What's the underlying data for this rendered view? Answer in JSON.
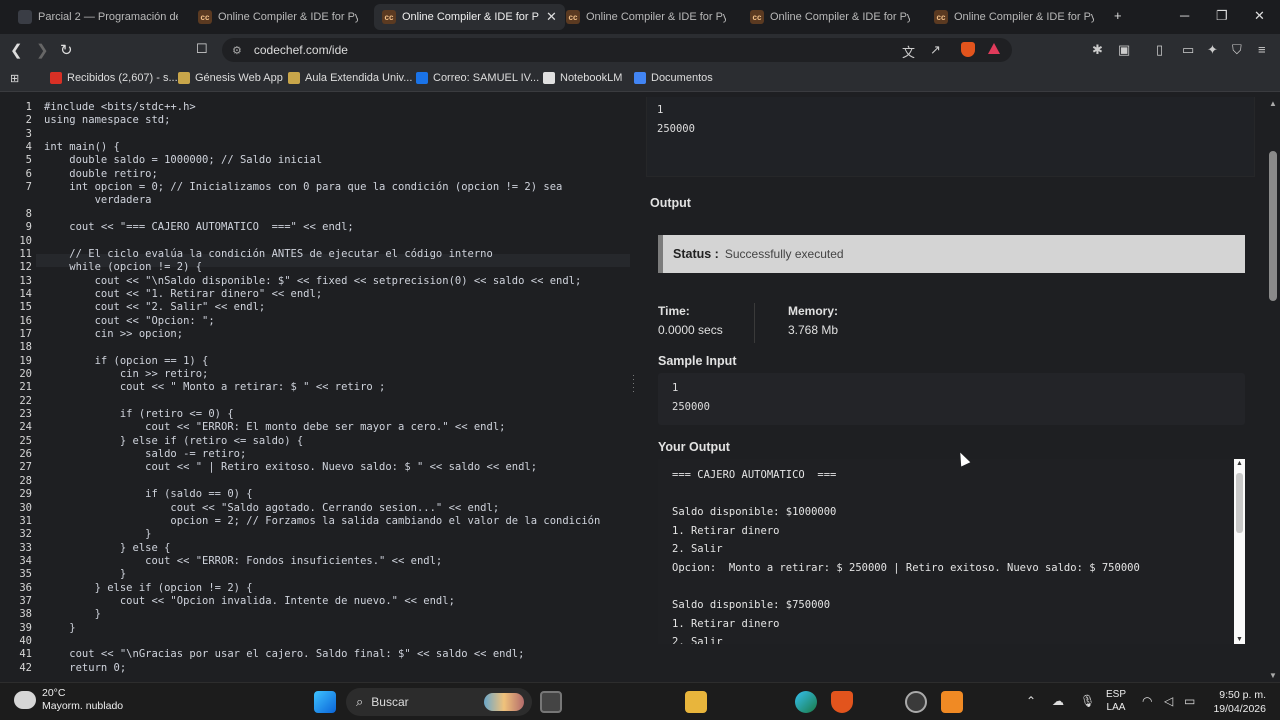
{
  "browser": {
    "tabs": [
      {
        "label": "Parcial 2 — Programación de Co",
        "favicon": "uni"
      },
      {
        "label": "Online Compiler & IDE for Pytho",
        "favicon": "cc"
      },
      {
        "label": "Online Compiler & IDE for P",
        "favicon": "cc",
        "active": true
      },
      {
        "label": "Online Compiler & IDE for Pytho",
        "favicon": "cc"
      },
      {
        "label": "Online Compiler & IDE for Pytho",
        "favicon": "cc"
      },
      {
        "label": "Online Compiler & IDE for Pytho",
        "favicon": "cc"
      }
    ],
    "url": "codechef.com/ide",
    "bookmarks": [
      {
        "label": "Recibidos (2,607) - s...",
        "color": "#d93025"
      },
      {
        "label": "Génesis Web App",
        "color": "#c9a64a"
      },
      {
        "label": "Aula Extendida Univ...",
        "color": "#c9a64a"
      },
      {
        "label": "Correo: SAMUEL IV...",
        "color": "#1a73e8"
      },
      {
        "label": "NotebookLM",
        "color": "#e0e0e0"
      },
      {
        "label": "Documentos",
        "color": "#4285f4"
      }
    ]
  },
  "editor": {
    "lines": [
      {
        "n": "1",
        "code": "#include <bits/stdc++.h>"
      },
      {
        "n": "2",
        "code": "using namespace std;"
      },
      {
        "n": "3",
        "code": ""
      },
      {
        "n": "4",
        "code": "int main() {"
      },
      {
        "n": "5",
        "code": "    double saldo = 1000000; // Saldo inicial"
      },
      {
        "n": "6",
        "code": "    double retiro;"
      },
      {
        "n": "7",
        "code": "    int opcion = 0; // Inicializamos con 0 para que la condición (opcion != 2) sea"
      },
      {
        "n": "",
        "code": "        verdadera"
      },
      {
        "n": "8",
        "code": ""
      },
      {
        "n": "9",
        "code": "    cout << \"=== CAJERO AUTOMATICO  ===\" << endl;"
      },
      {
        "n": "10",
        "code": ""
      },
      {
        "n": "11",
        "code": "    // El ciclo evalúa la condición ANTES de ejecutar el código interno"
      },
      {
        "n": "12",
        "code": "    while (opcion != 2) {"
      },
      {
        "n": "13",
        "code": "        cout << \"\\nSaldo disponible: $\" << fixed << setprecision(0) << saldo << endl;"
      },
      {
        "n": "14",
        "code": "        cout << \"1. Retirar dinero\" << endl;"
      },
      {
        "n": "15",
        "code": "        cout << \"2. Salir\" << endl;"
      },
      {
        "n": "16",
        "code": "        cout << \"Opcion: \";"
      },
      {
        "n": "17",
        "code": "        cin >> opcion;"
      },
      {
        "n": "18",
        "code": ""
      },
      {
        "n": "19",
        "code": "        if (opcion == 1) {"
      },
      {
        "n": "20",
        "code": "            cin >> retiro;"
      },
      {
        "n": "21",
        "code": "            cout << \" Monto a retirar: $ \" << retiro ;"
      },
      {
        "n": "22",
        "code": ""
      },
      {
        "n": "23",
        "code": "            if (retiro <= 0) {"
      },
      {
        "n": "24",
        "code": "                cout << \"ERROR: El monto debe ser mayor a cero.\" << endl;"
      },
      {
        "n": "25",
        "code": "            } else if (retiro <= saldo) {"
      },
      {
        "n": "26",
        "code": "                saldo -= retiro;"
      },
      {
        "n": "27",
        "code": "                cout << \" | Retiro exitoso. Nuevo saldo: $ \" << saldo << endl;"
      },
      {
        "n": "28",
        "code": ""
      },
      {
        "n": "29",
        "code": "                if (saldo == 0) {"
      },
      {
        "n": "30",
        "code": "                    cout << \"Saldo agotado. Cerrando sesion...\" << endl;"
      },
      {
        "n": "31",
        "code": "                    opcion = 2; // Forzamos la salida cambiando el valor de la condición"
      },
      {
        "n": "32",
        "code": "                }"
      },
      {
        "n": "33",
        "code": "            } else {"
      },
      {
        "n": "34",
        "code": "                cout << \"ERROR: Fondos insuficientes.\" << endl;"
      },
      {
        "n": "35",
        "code": "            }"
      },
      {
        "n": "36",
        "code": "        } else if (opcion != 2) {"
      },
      {
        "n": "37",
        "code": "            cout << \"Opcion invalida. Intente de nuevo.\" << endl;"
      },
      {
        "n": "38",
        "code": "        }"
      },
      {
        "n": "39",
        "code": "    }"
      },
      {
        "n": "40",
        "code": ""
      },
      {
        "n": "41",
        "code": "    cout << \"\\nGracias por usar el cajero. Saldo final: $\" << saldo << endl;"
      },
      {
        "n": "42",
        "code": "    return 0;"
      }
    ]
  },
  "right": {
    "top_input": [
      "1",
      "250000"
    ],
    "output_heading": "Output",
    "status_label": "Status :",
    "status_value": "Successfully executed",
    "time_label": "Time:",
    "time_value": "0.0000 secs",
    "memory_label": "Memory:",
    "memory_value": "3.768 Mb",
    "sample_input_heading": "Sample Input",
    "sample_input": [
      "1",
      "250000"
    ],
    "your_output_heading": "Your Output",
    "your_output": [
      "=== CAJERO AUTOMATICO  ===",
      "",
      "Saldo disponible: $1000000",
      "1. Retirar dinero",
      "2. Salir",
      "Opcion:  Monto a retirar: $ 250000 | Retiro exitoso. Nuevo saldo: $ 750000",
      "",
      "Saldo disponible: $750000",
      "1. Retirar dinero",
      "2. Salir"
    ]
  },
  "taskbar": {
    "temp": "20°C",
    "weather": "Mayorm. nublado",
    "search": "Buscar",
    "lang1": "ESP",
    "lang2": "LAA",
    "time": "9:50 p. m.",
    "date": "19/04/2026"
  }
}
